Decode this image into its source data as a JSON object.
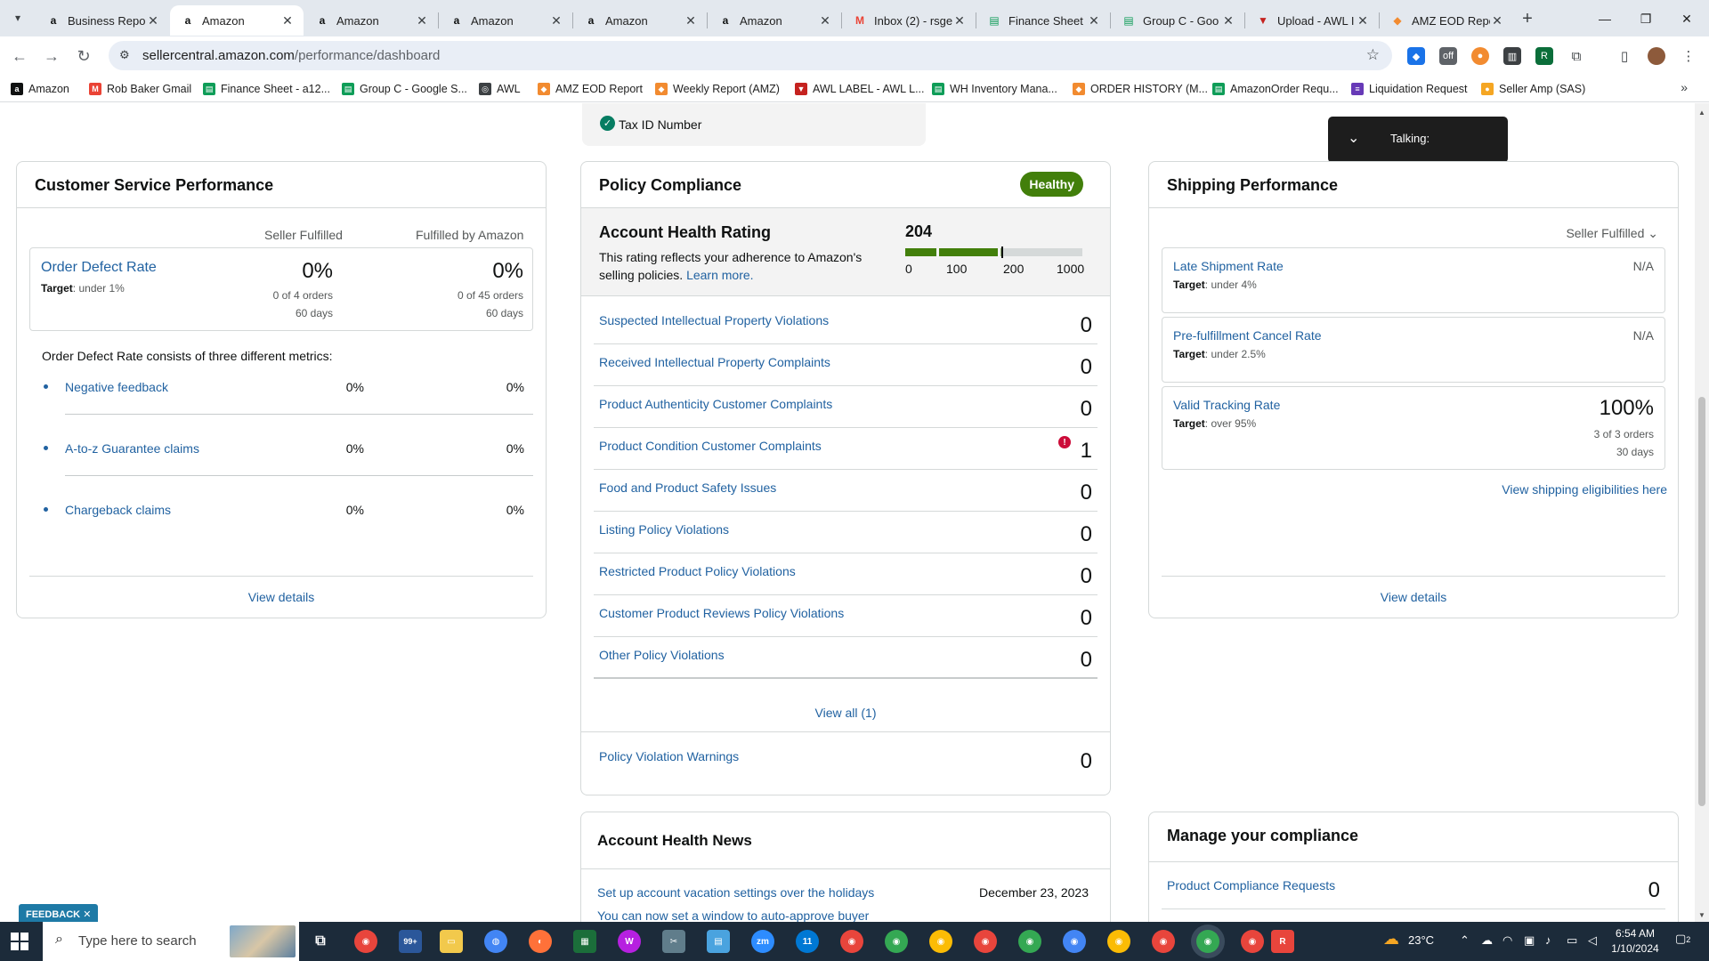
{
  "browser": {
    "tabs": [
      {
        "title": "Business Repor",
        "favicon": "amazon-a",
        "active": false
      },
      {
        "title": "Amazon",
        "favicon": "amazon-a",
        "active": true
      },
      {
        "title": "Amazon",
        "favicon": "amazon-a",
        "active": false
      },
      {
        "title": "Amazon",
        "favicon": "amazon-a",
        "active": false
      },
      {
        "title": "Amazon",
        "favicon": "amazon-a",
        "active": false
      },
      {
        "title": "Amazon",
        "favicon": "amazon-a",
        "active": false
      },
      {
        "title": "Inbox (2) - rsge",
        "favicon": "gmail",
        "active": false
      },
      {
        "title": "Finance Sheet",
        "favicon": "sheets",
        "active": false
      },
      {
        "title": "Group C - Goo",
        "favicon": "sheets",
        "active": false
      },
      {
        "title": "Upload - AWL I",
        "favicon": "awl",
        "active": false
      },
      {
        "title": "AMZ EOD Repo",
        "favicon": "report",
        "active": false
      }
    ],
    "url_host": "sellercentral.amazon.com",
    "url_path": "/performance/dashboard",
    "bookmarks": [
      {
        "label": "Amazon",
        "icon": "amazon-a"
      },
      {
        "label": "Rob Baker Gmail",
        "icon": "gmail"
      },
      {
        "label": "Finance Sheet - a12...",
        "icon": "sheets"
      },
      {
        "label": "Group C - Google S...",
        "icon": "sheets"
      },
      {
        "label": "AWL",
        "icon": "globe"
      },
      {
        "label": "AMZ EOD Report",
        "icon": "report"
      },
      {
        "label": "Weekly Report (AMZ)",
        "icon": "report"
      },
      {
        "label": "AWL LABEL - AWL L...",
        "icon": "awl"
      },
      {
        "label": "WH Inventory Mana...",
        "icon": "sheets"
      },
      {
        "label": "ORDER HISTORY (M...",
        "icon": "report"
      },
      {
        "label": "AmazonOrder Requ...",
        "icon": "sheets"
      },
      {
        "label": "Liquidation Request",
        "icon": "forms"
      },
      {
        "label": "Seller Amp (SAS)",
        "icon": "selleramp"
      }
    ]
  },
  "colors": {
    "link": "#2162a1",
    "healthy_badge": "#427f0b",
    "bar_green": "#427f0b",
    "alert_red": "#cc0c39",
    "taskbar": "#1c2b3a"
  },
  "page": {
    "tax_id": {
      "label": "Tax ID Number"
    },
    "talking": {
      "label": "Talking:"
    },
    "customer_service": {
      "title": "Customer Service Performance",
      "col_seller": "Seller Fulfilled",
      "col_fba": "Fulfilled by Amazon",
      "odr": {
        "name": "Order Defect Rate",
        "target_label": "Target",
        "target_value": ": under 1%",
        "seller_pct": "0%",
        "seller_orders": "0 of 4 orders",
        "seller_days": "60 days",
        "fba_pct": "0%",
        "fba_orders": "0 of 45 orders",
        "fba_days": "60 days"
      },
      "consists_text": "Order Defect Rate consists of three different metrics:",
      "metrics": [
        {
          "name": "Negative feedback",
          "seller": "0%",
          "fba": "0%"
        },
        {
          "name": "A-to-z Guarantee claims",
          "seller": "0%",
          "fba": "0%"
        },
        {
          "name": "Chargeback claims",
          "seller": "0%",
          "fba": "0%"
        }
      ],
      "view_details": "View details"
    },
    "policy": {
      "title": "Policy Compliance",
      "badge": "Healthy",
      "ahr_title": "Account Health Rating",
      "ahr_desc": "This rating reflects your adherence to Amazon's selling policies.",
      "learn_more": "Learn more.",
      "score": "204",
      "score_value": 204,
      "ticks": [
        "0",
        "100",
        "200",
        "1000"
      ],
      "rows": [
        {
          "name": "Suspected Intellectual Property Violations",
          "value": "0"
        },
        {
          "name": "Received Intellectual Property Complaints",
          "value": "0"
        },
        {
          "name": "Product Authenticity Customer Complaints",
          "value": "0"
        },
        {
          "name": "Product Condition Customer Complaints",
          "value": "1",
          "alert": true
        },
        {
          "name": "Food and Product Safety Issues",
          "value": "0"
        },
        {
          "name": "Listing Policy Violations",
          "value": "0"
        },
        {
          "name": "Restricted Product Policy Violations",
          "value": "0"
        },
        {
          "name": "Customer Product Reviews Policy Violations",
          "value": "0"
        },
        {
          "name": "Other Policy Violations",
          "value": "0"
        }
      ],
      "view_all": "View all (1)",
      "warnings": {
        "name": "Policy Violation Warnings",
        "value": "0"
      }
    },
    "shipping": {
      "title": "Shipping Performance",
      "dropdown": "Seller Fulfilled",
      "metrics": [
        {
          "name": "Late Shipment Rate",
          "target_label": "Target",
          "target_value": ": under 4%",
          "value": "N/A"
        },
        {
          "name": "Pre-fulfillment Cancel Rate",
          "target_label": "Target",
          "target_value": ": under 2.5%",
          "value": "N/A"
        },
        {
          "name": "Valid Tracking Rate",
          "target_label": "Target",
          "target_value": ": over 95%",
          "value": "100%",
          "orders": "3 of 3 orders",
          "days": "30 days"
        }
      ],
      "eligibilities": "View shipping eligibilities here",
      "view_details": "View details"
    },
    "news": {
      "title": "Account Health News",
      "items": [
        {
          "text": "Set up account vacation settings over the holidays",
          "date": "December 23, 2023"
        },
        {
          "text": "You can now set a window to auto-approve buyer",
          "date": ""
        }
      ]
    },
    "manage": {
      "title": "Manage your compliance",
      "rows": [
        {
          "name": "Product Compliance Requests",
          "value": "0"
        }
      ]
    },
    "feedback": "FEEDBACK"
  },
  "taskbar": {
    "search_placeholder": "Type here to search",
    "mail_badge": "99+",
    "weather": "23°C",
    "time": "6:54 AM",
    "date": "1/10/2024",
    "notif_count": "2",
    "calendar_badge": "11"
  }
}
